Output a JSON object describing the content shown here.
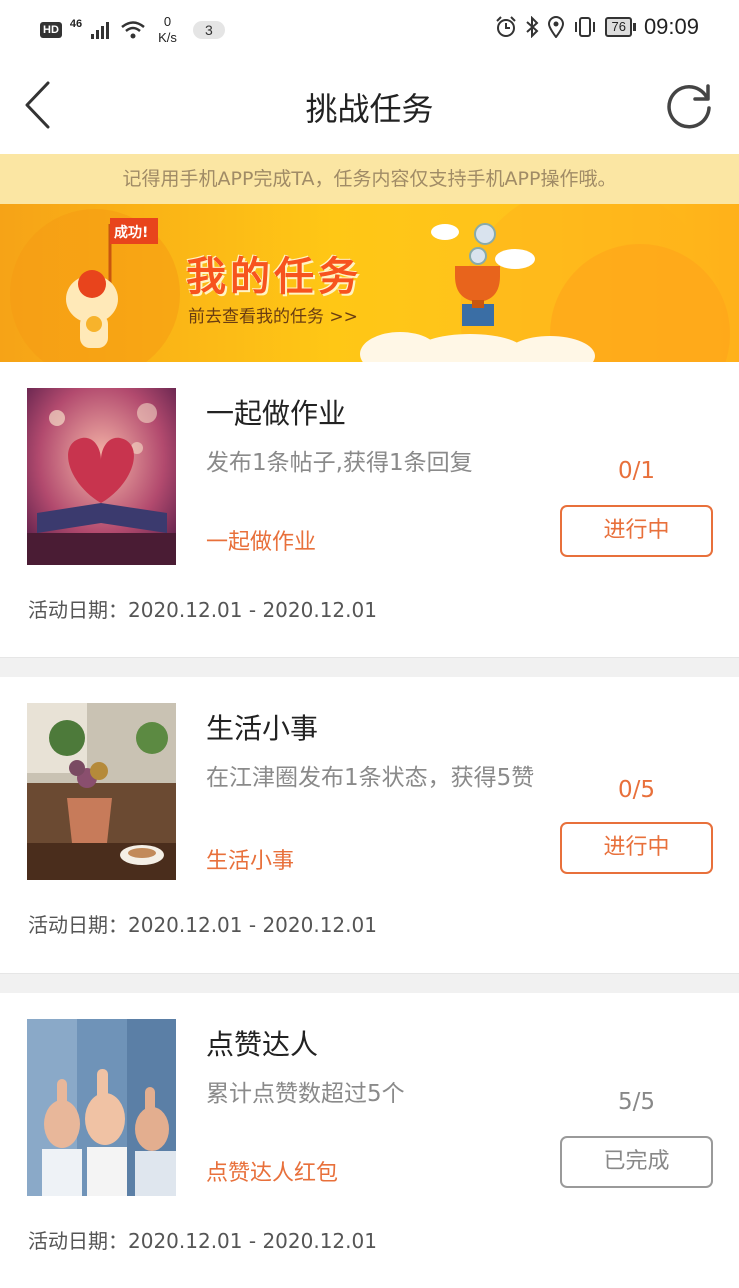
{
  "status_bar": {
    "hd": "HD",
    "network": "46",
    "speed_value": "0",
    "speed_unit": "K/s",
    "notification_count": "3",
    "battery": "76",
    "time": "09:09"
  },
  "header": {
    "title": "挑战任务"
  },
  "notice": {
    "text": "记得用手机APP完成TA，任务内容仅支持手机APP操作哦。"
  },
  "banner": {
    "badge": "成功!",
    "title": "我的任务",
    "subtitle": "前去查看我的任务 >>"
  },
  "tasks": [
    {
      "title": "一起做作业",
      "description": "发布1条帖子,获得1条回复",
      "tag": "一起做作业",
      "progress": "0/1",
      "status": "进行中",
      "date": "活动日期：2020.12.01 - 2020.12.01"
    },
    {
      "title": "生活小事",
      "description": "在江津圈发布1条状态，获得5赞",
      "tag": "生活小事",
      "progress": "0/5",
      "status": "进行中",
      "date": "活动日期：2020.12.01 - 2020.12.01"
    },
    {
      "title": "点赞达人",
      "description": "累计点赞数超过5个",
      "tag": "点赞达人红包",
      "progress": "5/5",
      "status": "已完成",
      "date": "活动日期：2020.12.01 - 2020.12.01"
    }
  ],
  "colors": {
    "accent": "#e8703b",
    "notice_bg": "#fbe6a3",
    "banner_yellow": "#ffc715",
    "done_gray": "#888888"
  }
}
